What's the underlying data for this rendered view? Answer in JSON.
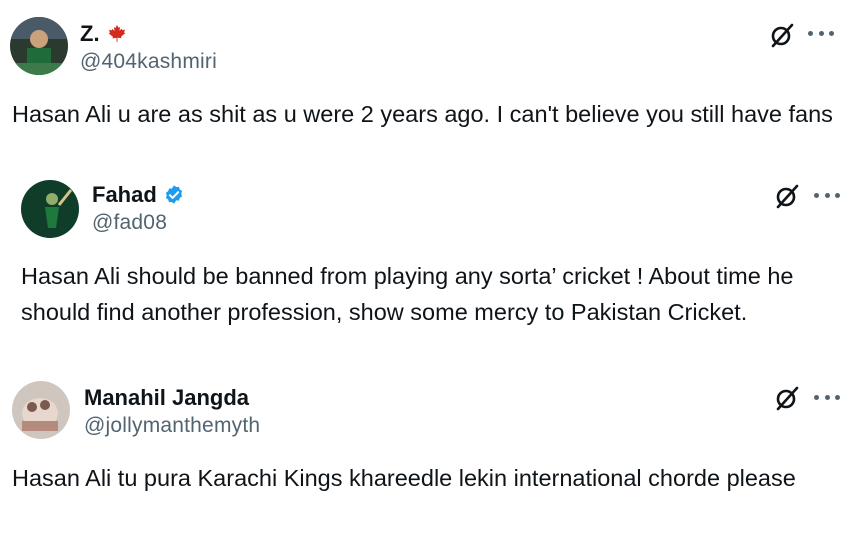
{
  "tweets": [
    {
      "display_name": "Z.",
      "handle": "@404kashmiri",
      "badge": "canada-flag-icon",
      "text": "Hasan Ali u are as shit as u were 2 years ago. I can't believe you still have fans"
    },
    {
      "display_name": "Fahad",
      "handle": "@fad08",
      "badge": "verified-icon",
      "text": "Hasan Ali should be banned from playing any sorta’ cricket ! About time he should find another profession, show some mercy to Pakistan Cricket."
    },
    {
      "display_name": "Manahil Jangda",
      "handle": "@jollymanthemyth",
      "badge": "",
      "text": "Hasan Ali tu pura Karachi Kings khareedle lekin international chorde please"
    }
  ],
  "colors": {
    "text": "#0f1419",
    "secondary": "#536471",
    "verified_blue": "#1d9bf0",
    "flag_red": "#d52b1e"
  }
}
